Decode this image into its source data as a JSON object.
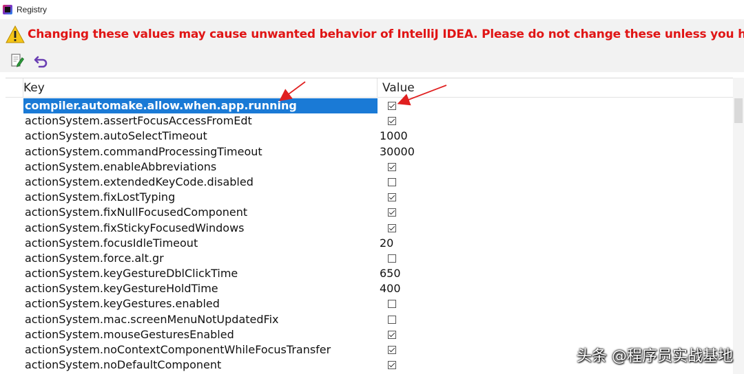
{
  "window": {
    "title": "Registry",
    "app_icon": "intellij-icon"
  },
  "banner": {
    "icon": "warning-triangle-icon",
    "text": "Changing these values may cause unwanted behavior of IntelliJ IDEA. Please do not change these unless you have been asked",
    "text_color": "#e01515"
  },
  "toolbar": {
    "edit_icon": "edit-document-icon",
    "revert_icon": "revert-undo-icon"
  },
  "table": {
    "columns": [
      "Key",
      "Value"
    ],
    "selected_color": "#1a7ad6",
    "rows": [
      {
        "key": "compiler.automake.allow.when.app.running",
        "type": "bool",
        "value": true,
        "selected": true
      },
      {
        "key": "actionSystem.assertFocusAccessFromEdt",
        "type": "bool",
        "value": true
      },
      {
        "key": "actionSystem.autoSelectTimeout",
        "type": "text",
        "value": "1000"
      },
      {
        "key": "actionSystem.commandProcessingTimeout",
        "type": "text",
        "value": "30000"
      },
      {
        "key": "actionSystem.enableAbbreviations",
        "type": "bool",
        "value": true
      },
      {
        "key": "actionSystem.extendedKeyCode.disabled",
        "type": "bool",
        "value": false
      },
      {
        "key": "actionSystem.fixLostTyping",
        "type": "bool",
        "value": true
      },
      {
        "key": "actionSystem.fixNullFocusedComponent",
        "type": "bool",
        "value": true
      },
      {
        "key": "actionSystem.fixStickyFocusedWindows",
        "type": "bool",
        "value": true
      },
      {
        "key": "actionSystem.focusIdleTimeout",
        "type": "text",
        "value": "20"
      },
      {
        "key": "actionSystem.force.alt.gr",
        "type": "bool",
        "value": false
      },
      {
        "key": "actionSystem.keyGestureDblClickTime",
        "type": "text",
        "value": "650"
      },
      {
        "key": "actionSystem.keyGestureHoldTime",
        "type": "text",
        "value": "400"
      },
      {
        "key": "actionSystem.keyGestures.enabled",
        "type": "bool",
        "value": false
      },
      {
        "key": "actionSystem.mac.screenMenuNotUpdatedFix",
        "type": "bool",
        "value": false
      },
      {
        "key": "actionSystem.mouseGesturesEnabled",
        "type": "bool",
        "value": true
      },
      {
        "key": "actionSystem.noContextComponentWhileFocusTransfer",
        "type": "bool",
        "value": true
      },
      {
        "key": "actionSystem.noDefaultComponent",
        "type": "bool",
        "value": true
      }
    ]
  },
  "annotation": {
    "arrow_color": "#e02020"
  },
  "watermark": {
    "text": "头条 @程序员实战基地"
  }
}
